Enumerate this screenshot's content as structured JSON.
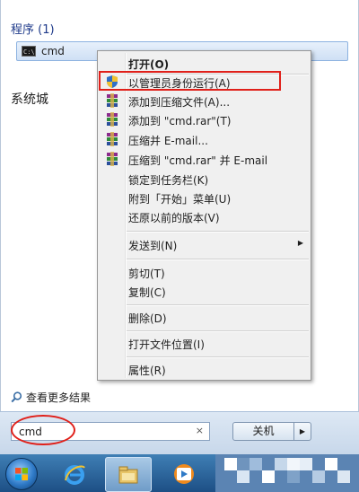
{
  "start_menu": {
    "section_header": "程序 (1)",
    "result": {
      "icon": "cmd-icon",
      "label": "cmd"
    },
    "side_text": "系统城",
    "see_more": {
      "icon": "search-icon",
      "label": "查看更多结果"
    },
    "search": {
      "value": "cmd",
      "clear": "×"
    },
    "shutdown": {
      "label": "关机",
      "arrow": "▶"
    }
  },
  "context_menu": {
    "items": [
      {
        "label": "打开(O)",
        "bold": true
      },
      {
        "label": "以管理员身份运行(A)",
        "icon": "shield-icon"
      },
      {
        "label": "添加到压缩文件(A)...",
        "icon": "winrar-icon"
      },
      {
        "label": "添加到 \"cmd.rar\"(T)",
        "icon": "winrar-icon"
      },
      {
        "label": "压缩并 E-mail...",
        "icon": "winrar-icon"
      },
      {
        "label": "压缩到 \"cmd.rar\" 并 E-mail",
        "icon": "winrar-icon"
      },
      {
        "label": "锁定到任务栏(K)"
      },
      {
        "label": "附到「开始」菜单(U)"
      },
      {
        "label": "还原以前的版本(V)"
      },
      {
        "label": "发送到(N)",
        "submenu_arrow": "▶"
      },
      {
        "label": "剪切(T)"
      },
      {
        "label": "复制(C)"
      },
      {
        "label": "删除(D)"
      },
      {
        "label": "打开文件位置(I)"
      },
      {
        "label": "属性(R)"
      }
    ]
  },
  "taskbar": {
    "start_button": "windows-start-orb",
    "buttons": [
      "ie-icon",
      "explorer-icon",
      "media-player-icon"
    ]
  },
  "colors": {
    "highlight_annotation": "#e0201a",
    "taskbar": "#2a5f96",
    "menu_background": "#f0f0f0"
  }
}
